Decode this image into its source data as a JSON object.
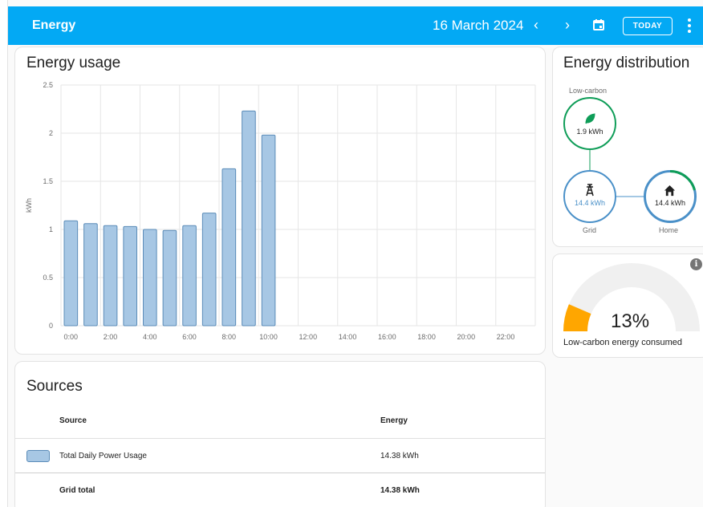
{
  "header": {
    "title": "Energy",
    "date": "16 March 2024",
    "prev_glyph": "‹",
    "next_glyph": "›",
    "today_label": "TODAY"
  },
  "usage_card": {
    "title": "Energy usage"
  },
  "chart_data": {
    "type": "bar",
    "title": "Energy usage",
    "ylabel": "kWh",
    "xlabel": "",
    "ylim": [
      0,
      2.5
    ],
    "y_ticks": [
      "0",
      "0.5",
      "1",
      "1.5",
      "2",
      "2.5"
    ],
    "x_tick_labels": [
      "0:00",
      "2:00",
      "4:00",
      "6:00",
      "8:00",
      "10:00",
      "12:00",
      "14:00",
      "16:00",
      "18:00",
      "20:00",
      "22:00"
    ],
    "categories": [
      "0:00",
      "1:00",
      "2:00",
      "3:00",
      "4:00",
      "5:00",
      "6:00",
      "7:00",
      "8:00",
      "9:00",
      "10:00"
    ],
    "values": [
      1.09,
      1.06,
      1.04,
      1.03,
      1.0,
      0.99,
      1.04,
      1.17,
      1.63,
      2.23,
      1.98
    ],
    "grid": true,
    "bar_color": "#a7c7e4",
    "bar_edge_color": "#5b8cb8"
  },
  "sources_card": {
    "title": "Sources",
    "columns": [
      "Source",
      "Energy"
    ],
    "rows": [
      {
        "name": "Total Daily Power Usage",
        "energy": "14.38 kWh"
      }
    ],
    "total": {
      "name": "Grid total",
      "energy": "14.38 kWh"
    }
  },
  "distribution_card": {
    "title": "Energy distribution",
    "low_carbon": {
      "label": "Low-carbon",
      "value": "1.9 kWh",
      "icon": "leaf-icon",
      "color": "#0f9d58"
    },
    "grid": {
      "label": "Grid",
      "value": "14.4 kWh",
      "icon": "transmission-tower-icon",
      "color": "#4a90c8"
    },
    "home": {
      "label": "Home",
      "value": "14.4 kWh",
      "icon": "home-icon",
      "color": "#4a90c8"
    }
  },
  "gauge_card": {
    "percent": "13%",
    "label": "Low-carbon energy consumed",
    "value_fraction": 0.13,
    "fill_color": "#ffa600",
    "track_color": "#f0f0f0"
  }
}
